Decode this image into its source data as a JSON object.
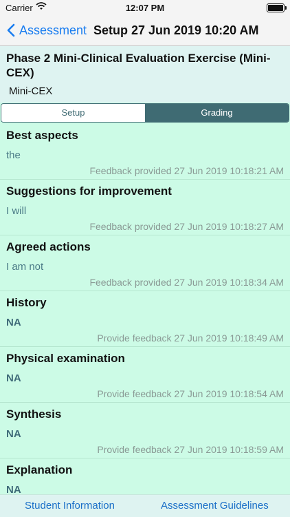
{
  "status": {
    "carrier": "Carrier",
    "time": "12:07 PM"
  },
  "nav": {
    "back_label": "Assessment",
    "title": "Setup 27 Jun 2019 10:20 AM"
  },
  "header": {
    "title": "Phase 2 Mini-Clinical Evaluation Exercise (Mini-CEX)",
    "subtitle": "Mini-CEX"
  },
  "tabs": {
    "setup": "Setup",
    "grading": "Grading",
    "selected": "Grading"
  },
  "items": [
    {
      "title": "Best aspects",
      "value": "the",
      "meta": "Feedback provided 27 Jun 2019 10:18:21 AM"
    },
    {
      "title": "Suggestions for improvement",
      "value": "I will",
      "meta": "Feedback provided 27 Jun 2019 10:18:27 AM"
    },
    {
      "title": "Agreed actions",
      "value": "I am not",
      "meta": "Feedback provided 27 Jun 2019 10:18:34 AM"
    },
    {
      "title": "History",
      "value": "NA",
      "meta": "Provide feedback 27 Jun 2019 10:18:49 AM"
    },
    {
      "title": "Physical examination",
      "value": "NA",
      "meta": "Provide feedback 27 Jun 2019 10:18:54 AM"
    },
    {
      "title": "Synthesis",
      "value": "NA",
      "meta": "Provide feedback 27 Jun 2019 10:18:59 AM"
    },
    {
      "title": "Explanation",
      "value": "NA",
      "meta": ""
    }
  ],
  "bottom": {
    "left": "Student Information",
    "right": "Assessment Guidelines"
  },
  "icons": {
    "wifi": "wifi-icon",
    "battery": "battery-icon",
    "back": "chevron-left-icon"
  },
  "colors": {
    "background": "#ccfbe6",
    "accent": "#3f6b73",
    "link": "#1a7df0"
  }
}
